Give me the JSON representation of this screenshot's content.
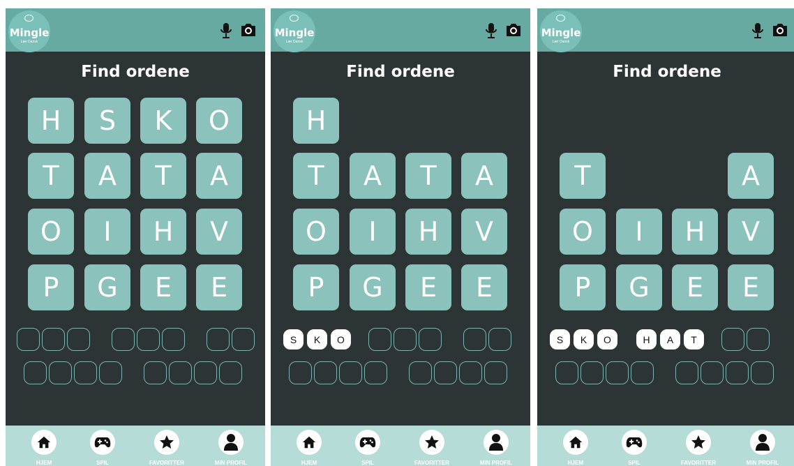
{
  "app": {
    "logo_name": "Mingle",
    "logo_tagline": "Lær Dansk"
  },
  "page": {
    "title": "Find ordene"
  },
  "nav": [
    {
      "label": "HJEM",
      "icon": "home-icon"
    },
    {
      "label": "SPIL",
      "icon": "gamepad-icon"
    },
    {
      "label": "FAVORITTER",
      "icon": "star-icon"
    },
    {
      "label": "MIN PROFIL",
      "icon": "user-icon"
    }
  ],
  "colors": {
    "header": "#67aaa2",
    "background": "#2d3436",
    "tile": "#8bc2bb",
    "nav": "#b6dcd7"
  },
  "screens": [
    {
      "grid": [
        [
          "H",
          "S",
          "K",
          "O"
        ],
        [
          "T",
          "A",
          "T",
          "A"
        ],
        [
          "O",
          "I",
          "H",
          "V"
        ],
        [
          "P",
          "G",
          "E",
          "E"
        ]
      ],
      "found_words": []
    },
    {
      "grid": [
        [
          "H",
          "",
          "",
          ""
        ],
        [
          "T",
          "A",
          "T",
          "A"
        ],
        [
          "O",
          "I",
          "H",
          "V"
        ],
        [
          "P",
          "G",
          "E",
          "E"
        ]
      ],
      "found_words": [
        "SKO"
      ]
    },
    {
      "grid": [
        [
          "",
          "",
          "",
          ""
        ],
        [
          "T",
          "",
          "",
          "A"
        ],
        [
          "O",
          "I",
          "H",
          "V"
        ],
        [
          "P",
          "G",
          "E",
          "E"
        ]
      ],
      "found_words": [
        "SKO",
        "HAT"
      ]
    }
  ],
  "word_slots": [
    [
      3,
      3,
      2
    ],
    [
      4,
      4
    ]
  ]
}
